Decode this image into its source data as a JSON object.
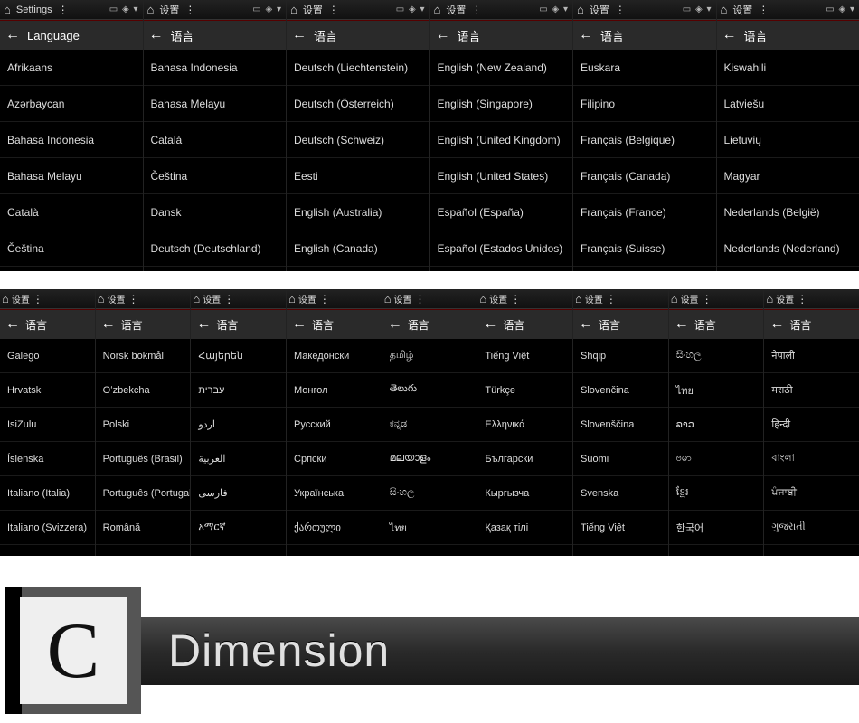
{
  "top_panels": [
    {
      "status_title": "Settings",
      "header": "Language",
      "items": [
        "Afrikaans",
        "Azərbaycan",
        "Bahasa Indonesia",
        "Bahasa Melayu",
        "Català",
        "Čeština"
      ]
    },
    {
      "status_title": "设置",
      "header": "语言",
      "items": [
        "Bahasa Indonesia",
        "Bahasa Melayu",
        "Català",
        "Čeština",
        "Dansk",
        "Deutsch (Deutschland)"
      ]
    },
    {
      "status_title": "设置",
      "header": "语言",
      "items": [
        "Deutsch (Liechtenstein)",
        "Deutsch (Österreich)",
        "Deutsch (Schweiz)",
        "Eesti",
        "English (Australia)",
        "English (Canada)"
      ]
    },
    {
      "status_title": "设置",
      "header": "语言",
      "items": [
        "English (New Zealand)",
        "English (Singapore)",
        "English (United Kingdom)",
        "English (United States)",
        "Español (España)",
        "Español (Estados Unidos)"
      ]
    },
    {
      "status_title": "设置",
      "header": "语言",
      "items": [
        "Euskara",
        "Filipino",
        "Français (Belgique)",
        "Français (Canada)",
        "Français (France)",
        "Français (Suisse)"
      ]
    },
    {
      "status_title": "设置",
      "header": "语言",
      "items": [
        "Kiswahili",
        "Latviešu",
        "Lietuvių",
        "Magyar",
        "Nederlands (België)",
        "Nederlands (Nederland)"
      ]
    }
  ],
  "bottom_status_title": "设置",
  "bottom_header": "语言",
  "bottom_panels": [
    {
      "items": [
        "Galego",
        "Hrvatski",
        "IsiZulu",
        "Íslenska",
        "Italiano (Italia)",
        "Italiano (Svizzera)"
      ]
    },
    {
      "items": [
        "Norsk bokmål",
        "Oʻzbekcha",
        "Polski",
        "Português (Brasil)",
        "Português (Portugal)",
        "Română"
      ]
    },
    {
      "items": [
        "Հայերեն",
        "עברית",
        "اردو",
        "العربية",
        "فارسی",
        "አማርኛ"
      ]
    },
    {
      "items": [
        "Македонски",
        "Монгол",
        "Русский",
        "Српски",
        "Українська",
        "ქართული"
      ]
    },
    {
      "items": [
        "தமிழ்",
        "తెలుగు",
        "ಕನ್ನಡ",
        "മലയാളം",
        "සිංහල",
        "ไทย"
      ]
    },
    {
      "items": [
        "Tiếng Việt",
        "Türkçe",
        "Ελληνικά",
        "Български",
        "Кыргызча",
        "Қазақ тілі"
      ]
    },
    {
      "items": [
        "Shqip",
        "Slovenčina",
        "Slovenščina",
        "Suomi",
        "Svenska",
        "Tiếng Việt"
      ]
    },
    {
      "items": [
        "සිංහල",
        "ไทย",
        "ລາວ",
        "ဗမာ",
        "ខ្មែរ",
        "한국어"
      ]
    },
    {
      "items": [
        "नेपाली",
        "मराठी",
        "हिन्दी",
        "বাংলা",
        "ਪੰਜਾਬੀ",
        "ગુજરાતી"
      ]
    }
  ],
  "dimension": {
    "letter": "C",
    "label": "Dimension"
  },
  "icons": {
    "home": "⌂",
    "back": "←",
    "dots": "⋮",
    "sys": "▭ ◈ ▾"
  }
}
